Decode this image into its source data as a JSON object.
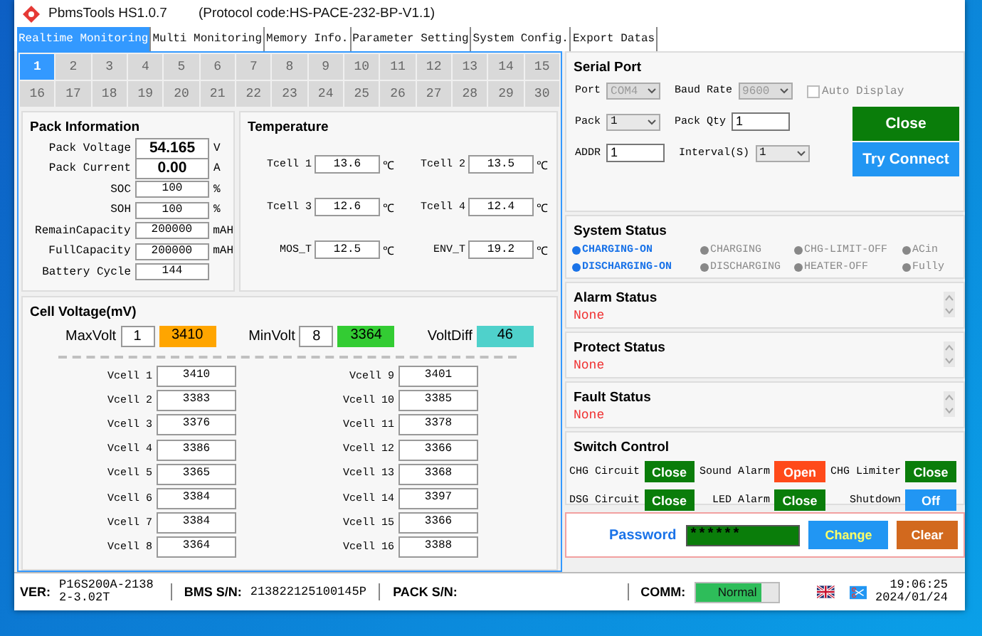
{
  "window": {
    "title": "PbmsTools HS1.0.7",
    "protocol": "(Protocol code:HS-PACE-232-BP-V1.1)"
  },
  "tabs": [
    {
      "label": "Realtime Monitoring",
      "selected": true
    },
    {
      "label": "Multi Monitoring",
      "selected": false
    },
    {
      "label": "Memory Info.",
      "selected": false
    },
    {
      "label": "Parameter Setting",
      "selected": false
    },
    {
      "label": "System Config.",
      "selected": false
    },
    {
      "label": "Export Datas",
      "selected": false
    }
  ],
  "packs": [
    {
      "label": "1",
      "selected": true
    },
    {
      "label": "2",
      "selected": false
    },
    {
      "label": "3",
      "selected": false
    },
    {
      "label": "4",
      "selected": false
    },
    {
      "label": "5",
      "selected": false
    },
    {
      "label": "6",
      "selected": false
    },
    {
      "label": "7",
      "selected": false
    },
    {
      "label": "8",
      "selected": false
    },
    {
      "label": "9",
      "selected": false
    },
    {
      "label": "10",
      "selected": false
    },
    {
      "label": "11",
      "selected": false
    },
    {
      "label": "12",
      "selected": false
    },
    {
      "label": "13",
      "selected": false
    },
    {
      "label": "14",
      "selected": false
    },
    {
      "label": "15",
      "selected": false
    },
    {
      "label": "16",
      "selected": false
    },
    {
      "label": "17",
      "selected": false
    },
    {
      "label": "18",
      "selected": false
    },
    {
      "label": "19",
      "selected": false
    },
    {
      "label": "20",
      "selected": false
    },
    {
      "label": "21",
      "selected": false
    },
    {
      "label": "22",
      "selected": false
    },
    {
      "label": "23",
      "selected": false
    },
    {
      "label": "24",
      "selected": false
    },
    {
      "label": "25",
      "selected": false
    },
    {
      "label": "26",
      "selected": false
    },
    {
      "label": "27",
      "selected": false
    },
    {
      "label": "28",
      "selected": false
    },
    {
      "label": "29",
      "selected": false
    },
    {
      "label": "30",
      "selected": false
    }
  ],
  "pack_info": {
    "title": "Pack Information",
    "rows": [
      {
        "label": "Pack Voltage",
        "value": "54.165",
        "unit": "V",
        "kind": "large"
      },
      {
        "label": "Pack Current",
        "value": "0.00",
        "unit": "A",
        "kind": "large"
      },
      {
        "label": "SOC",
        "value": "100",
        "unit": "%",
        "kind": "normal"
      },
      {
        "label": "SOH",
        "value": "100",
        "unit": "%",
        "kind": "normal"
      },
      {
        "label": "RemainCapacity",
        "value": "200000",
        "unit": "mAH",
        "kind": "normal"
      },
      {
        "label": "FullCapacity",
        "value": "200000",
        "unit": "mAH",
        "kind": "normal"
      },
      {
        "label": "Battery Cycle",
        "value": "144",
        "kind": "normal"
      }
    ]
  },
  "temperature": {
    "title": "Temperature",
    "rows": [
      [
        {
          "label": "Tcell 1",
          "value": "13.6",
          "unit": "℃"
        },
        {
          "label": "Tcell 2",
          "value": "13.5",
          "unit": "℃"
        }
      ],
      [
        {
          "label": "Tcell 3",
          "value": "12.6",
          "unit": "℃"
        },
        {
          "label": "Tcell 4",
          "value": "12.4",
          "unit": "℃"
        }
      ],
      [
        {
          "label": "MOS_T",
          "value": "12.5",
          "unit": "℃"
        },
        {
          "label": "ENV_T",
          "value": "19.2",
          "unit": "℃"
        }
      ]
    ]
  },
  "cell_voltage": {
    "title": "Cell Voltage(mV)",
    "summary": [
      {
        "label": "MaxVolt",
        "index": "1",
        "value": "3410",
        "color": "#ffa500"
      },
      {
        "label": "MinVolt",
        "index": "8",
        "value": "3364",
        "color": "#33cc33"
      },
      {
        "label": "VoltDiff",
        "value": "46",
        "color": "#4fd1cb"
      }
    ],
    "cells": [
      {
        "label": "Vcell 1",
        "value": "3410"
      },
      {
        "label": "Vcell 2",
        "value": "3383"
      },
      {
        "label": "Vcell 3",
        "value": "3376"
      },
      {
        "label": "Vcell 4",
        "value": "3386"
      },
      {
        "label": "Vcell 5",
        "value": "3365"
      },
      {
        "label": "Vcell 6",
        "value": "3384"
      },
      {
        "label": "Vcell 7",
        "value": "3384"
      },
      {
        "label": "Vcell 8",
        "value": "3364"
      },
      {
        "label": "Vcell 9",
        "value": "3401"
      },
      {
        "label": "Vcell 10",
        "value": "3385"
      },
      {
        "label": "Vcell 11",
        "value": "3378"
      },
      {
        "label": "Vcell 12",
        "value": "3366"
      },
      {
        "label": "Vcell 13",
        "value": "3368"
      },
      {
        "label": "Vcell 14",
        "value": "3397"
      },
      {
        "label": "Vcell 15",
        "value": "3366"
      },
      {
        "label": "Vcell 16",
        "value": "3388"
      }
    ]
  },
  "serial_port": {
    "title": "Serial Port",
    "rows": [
      [
        {
          "kind": "select",
          "label": "Port",
          "value": "COM4",
          "disabled": true
        },
        {
          "kind": "select",
          "label": "Baud Rate",
          "value": "9600",
          "disabled": true
        },
        {
          "kind": "checkbox",
          "label": "Auto Display",
          "checked": false,
          "disabled": true
        }
      ],
      [
        {
          "kind": "select",
          "label": "Pack",
          "value": "1",
          "disabled": false
        },
        {
          "kind": "input",
          "label": "Pack Qty",
          "value": "1",
          "disabled": false
        }
      ],
      [
        {
          "kind": "input",
          "label": "ADDR",
          "value": "1",
          "disabled": false
        },
        {
          "kind": "select",
          "label": "Interval(S)",
          "value": "1",
          "disabled": false
        }
      ]
    ],
    "buttons": [
      {
        "label": "Close",
        "color": "#0a7d0a"
      },
      {
        "label": "Try Connect",
        "color": "#2196f3"
      }
    ]
  },
  "system_status": {
    "title": "System Status",
    "items": [
      {
        "label": "CHARGING-ON",
        "on": true
      },
      {
        "label": "CHARGING",
        "on": false
      },
      {
        "label": "CHG-LIMIT-OFF",
        "on": false
      },
      {
        "label": "ACin",
        "on": false
      },
      {
        "label": "DISCHARGING-ON",
        "on": true
      },
      {
        "label": "DISCHARGING",
        "on": false
      },
      {
        "label": "HEATER-OFF",
        "on": false
      },
      {
        "label": "Fully",
        "on": false
      }
    ]
  },
  "status_boxes": [
    {
      "title": "Alarm Status",
      "text": "None"
    },
    {
      "title": "Protect Status",
      "text": "None"
    },
    {
      "title": "Fault Status",
      "text": "None"
    }
  ],
  "switch_control": {
    "title": "Switch Control",
    "items": [
      {
        "label": "CHG Circuit",
        "button": "Close",
        "color": "#0a7d0a"
      },
      {
        "label": "Sound Alarm",
        "button": "Open",
        "color": "#ff4a1a"
      },
      {
        "label": "CHG Limiter",
        "button": "Close",
        "color": "#0a7d0a"
      },
      {
        "label": "DSG Circuit",
        "button": "Close",
        "color": "#0a7d0a"
      },
      {
        "label": "LED Alarm",
        "button": "Close",
        "color": "#0a7d0a"
      },
      {
        "label": "Shutdown",
        "button": "Off",
        "color": "#2196f3"
      }
    ]
  },
  "password": {
    "label": "Password",
    "value": "******",
    "buttons": [
      {
        "label": "Change",
        "color": "#2196f3"
      },
      {
        "label": "Clear",
        "color": "#d2691e"
      }
    ]
  },
  "status_bar": {
    "ver_label": "VER:",
    "ver": "P16S200A-21382-3.02T",
    "bms_label": "BMS S/N:",
    "bms": "213822125100145P",
    "pack_label": "PACK S/N:",
    "comm_label": "COMM:",
    "comm": {
      "label": "Normal",
      "level": 0.79
    },
    "time": "19:06:25",
    "date": "2024/01/24"
  }
}
